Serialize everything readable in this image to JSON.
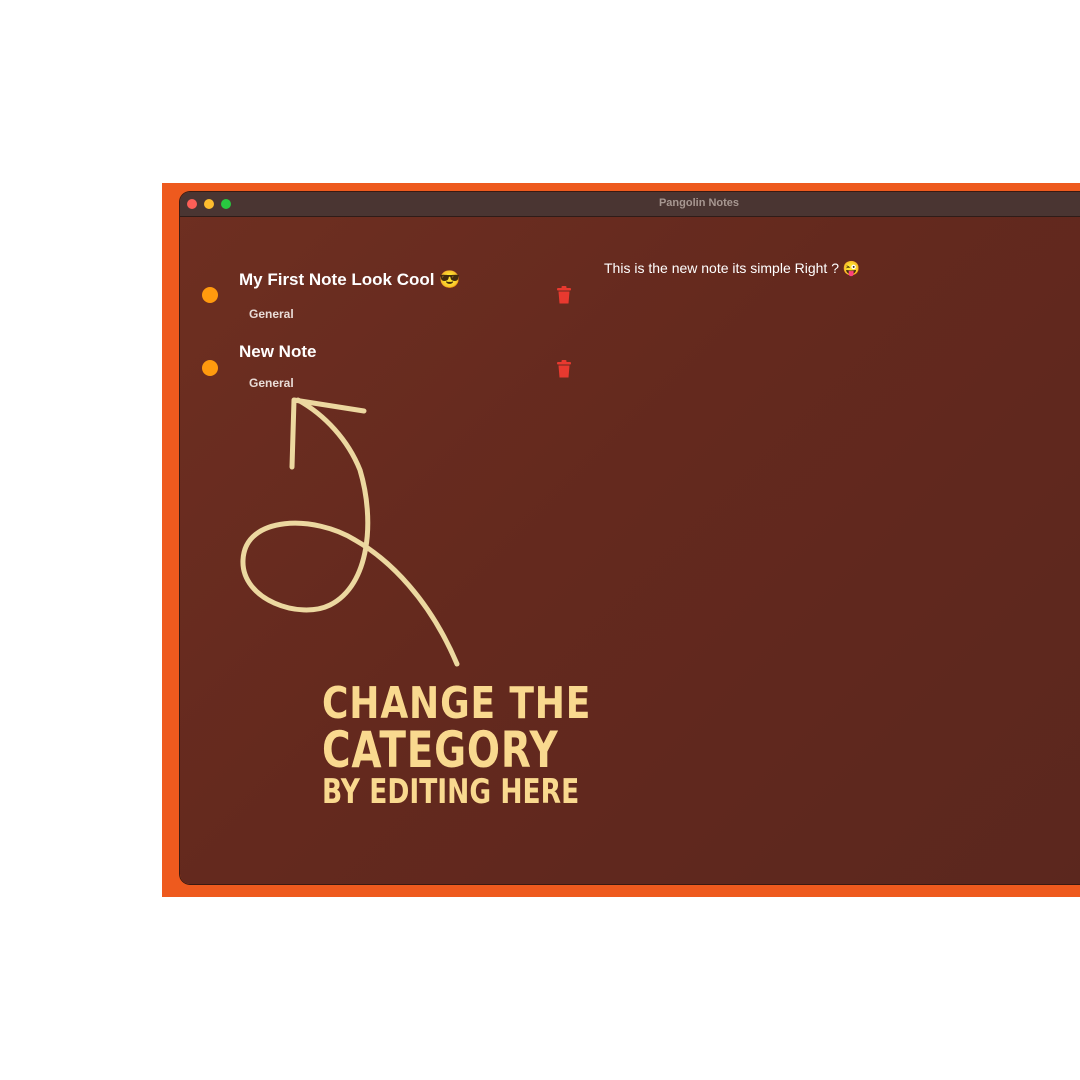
{
  "window": {
    "title": "Pangolin Notes"
  },
  "notes": [
    {
      "title": "My First Note Look Cool 😎",
      "category": "General",
      "dot_color": "#ff9a0e"
    },
    {
      "title": "New Note",
      "category": "General",
      "dot_color": "#ff9a0e"
    }
  ],
  "editor": {
    "text": "This is the new note its simple Right ? 😜"
  },
  "annotation": {
    "line1": "CHANGE THE",
    "line2": "CATEGORY",
    "line3": "BY EDITING HERE"
  },
  "icons": {
    "trash": "trash-icon"
  },
  "colors": {
    "backdrop": "#ee5a1e",
    "accent_trash": "#e8392f",
    "annotation": "#f9d98f"
  }
}
